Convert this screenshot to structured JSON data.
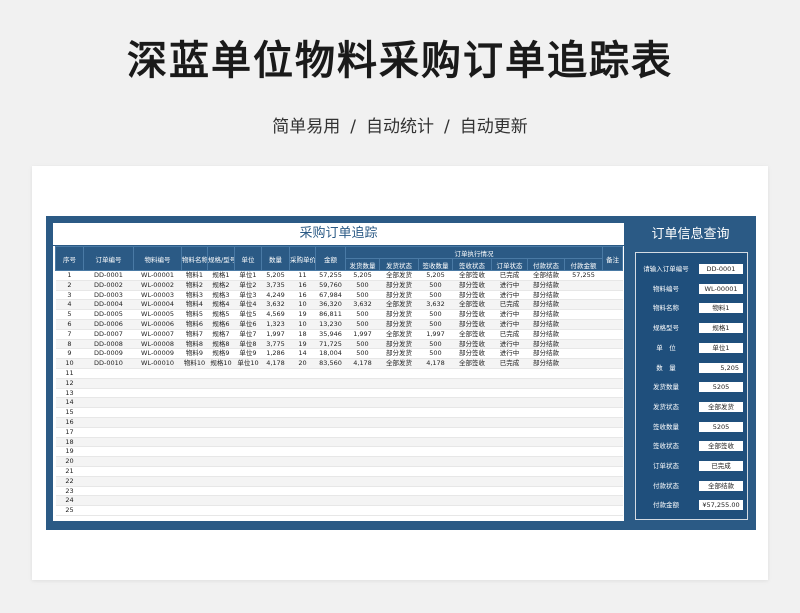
{
  "page": {
    "title": "深蓝单位物料采购订单追踪表",
    "subtitle_parts": [
      "简单易用",
      "/",
      "自动统计",
      "/",
      "自动更新"
    ]
  },
  "colors": {
    "primary": "#2b5a85",
    "accent_dark": "#1f4f7c",
    "card_bg": "#ffffff",
    "page_bg": "#f1f1f1"
  },
  "table": {
    "title": "采购订单追踪",
    "group_header": "订单执行情况",
    "headers": [
      "序号",
      "订单编号",
      "物料编号",
      "物料名称",
      "规格/型号",
      "单位",
      "数量",
      "采购单价",
      "金额",
      "发货数量",
      "发货状态",
      "签收数量",
      "签收状态",
      "订单状态",
      "付款状态",
      "付款金额",
      "备注"
    ],
    "rows": [
      [
        "1",
        "DD-0001",
        "WL-00001",
        "物料1",
        "规格1",
        "单位1",
        "5,205",
        "11",
        "57,255",
        "5,205",
        "全部发货",
        "5,205",
        "全部签收",
        "已完成",
        "全部结款",
        "57,255",
        ""
      ],
      [
        "2",
        "DD-0002",
        "WL-00002",
        "物料2",
        "规格2",
        "单位2",
        "3,735",
        "16",
        "59,760",
        "500",
        "部分发货",
        "500",
        "部分签收",
        "进行中",
        "部分结款",
        "",
        ""
      ],
      [
        "3",
        "DD-0003",
        "WL-00003",
        "物料3",
        "规格3",
        "单位3",
        "4,249",
        "16",
        "67,984",
        "500",
        "部分发货",
        "500",
        "部分签收",
        "进行中",
        "部分结款",
        "",
        ""
      ],
      [
        "4",
        "DD-0004",
        "WL-00004",
        "物料4",
        "规格4",
        "单位4",
        "3,632",
        "10",
        "36,320",
        "3,632",
        "全部发货",
        "3,632",
        "全部签收",
        "已完成",
        "部分结款",
        "",
        ""
      ],
      [
        "5",
        "DD-0005",
        "WL-00005",
        "物料5",
        "规格5",
        "单位5",
        "4,569",
        "19",
        "86,811",
        "500",
        "部分发货",
        "500",
        "部分签收",
        "进行中",
        "部分结款",
        "",
        ""
      ],
      [
        "6",
        "DD-0006",
        "WL-00006",
        "物料6",
        "规格6",
        "单位6",
        "1,323",
        "10",
        "13,230",
        "500",
        "部分发货",
        "500",
        "部分签收",
        "进行中",
        "部分结款",
        "",
        ""
      ],
      [
        "7",
        "DD-0007",
        "WL-00007",
        "物料7",
        "规格7",
        "单位7",
        "1,997",
        "18",
        "35,946",
        "1,997",
        "全部发货",
        "1,997",
        "全部签收",
        "已完成",
        "部分结款",
        "",
        ""
      ],
      [
        "8",
        "DD-0008",
        "WL-00008",
        "物料8",
        "规格8",
        "单位8",
        "3,775",
        "19",
        "71,725",
        "500",
        "部分发货",
        "500",
        "部分签收",
        "进行中",
        "部分结款",
        "",
        ""
      ],
      [
        "9",
        "DD-0009",
        "WL-00009",
        "物料9",
        "规格9",
        "单位9",
        "1,286",
        "14",
        "18,004",
        "500",
        "部分发货",
        "500",
        "部分签收",
        "进行中",
        "部分结款",
        "",
        ""
      ],
      [
        "10",
        "DD-0010",
        "WL-00010",
        "物料10",
        "规格10",
        "单位10",
        "4,178",
        "20",
        "83,560",
        "4,178",
        "全部发货",
        "4,178",
        "全部签收",
        "已完成",
        "部分结款",
        "",
        ""
      ],
      [
        "11"
      ],
      [
        "12"
      ],
      [
        "13"
      ],
      [
        "14"
      ],
      [
        "15"
      ],
      [
        "16"
      ],
      [
        "17"
      ],
      [
        "18"
      ],
      [
        "19"
      ],
      [
        "20"
      ],
      [
        "21"
      ],
      [
        "22"
      ],
      [
        "23"
      ],
      [
        "24"
      ],
      [
        "25"
      ]
    ]
  },
  "query": {
    "title": "订单信息查询",
    "fields": [
      {
        "label": "请输入订单编号",
        "value": "DD-0001"
      },
      {
        "label": "物料编号",
        "value": "WL-00001"
      },
      {
        "label": "物料名称",
        "value": "物料1"
      },
      {
        "label": "规格型号",
        "value": "规格1"
      },
      {
        "label": "单　位",
        "value": "单位1"
      },
      {
        "label": "数　量",
        "value": "5,205",
        "right": true
      },
      {
        "label": "发货数量",
        "value": "5205"
      },
      {
        "label": "发货状态",
        "value": "全部发货"
      },
      {
        "label": "签收数量",
        "value": "5205"
      },
      {
        "label": "签收状态",
        "value": "全部签收"
      },
      {
        "label": "订单状态",
        "value": "已完成"
      },
      {
        "label": "付款状态",
        "value": "全部结款"
      },
      {
        "label": "付款金额",
        "value": "¥57,255.00"
      }
    ]
  }
}
